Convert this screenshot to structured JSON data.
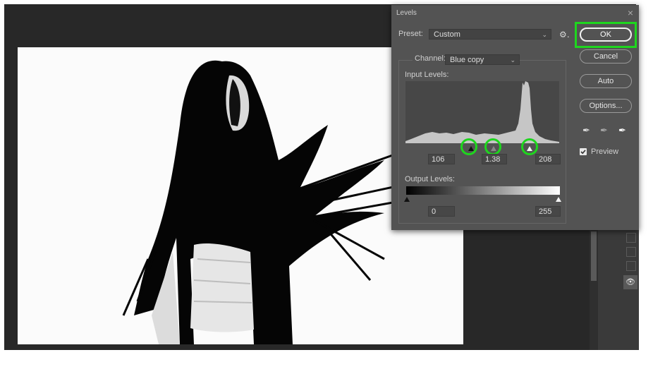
{
  "dialog": {
    "title": "Levels",
    "close_icon": "close-icon",
    "preset_label": "Preset:",
    "preset_value": "Custom",
    "preset_menu_icon": "gear-icon",
    "channel_label": "Channel:",
    "channel_value": "Blue copy",
    "input_levels_label": "Input Levels:",
    "input_black": "106",
    "input_gamma": "1.38",
    "input_white": "208",
    "output_levels_label": "Output Levels:",
    "output_black": "0",
    "output_white": "255",
    "buttons": {
      "ok": "OK",
      "cancel": "Cancel",
      "auto": "Auto",
      "options": "Options..."
    },
    "eyedroppers": [
      "black-eyedropper-icon",
      "gray-eyedropper-icon",
      "white-eyedropper-icon"
    ],
    "preview_label": "Preview",
    "preview_checked": true,
    "highlight_color": "#1ed61e"
  },
  "layers_panel": {
    "visibility_icon": "eye-icon"
  }
}
